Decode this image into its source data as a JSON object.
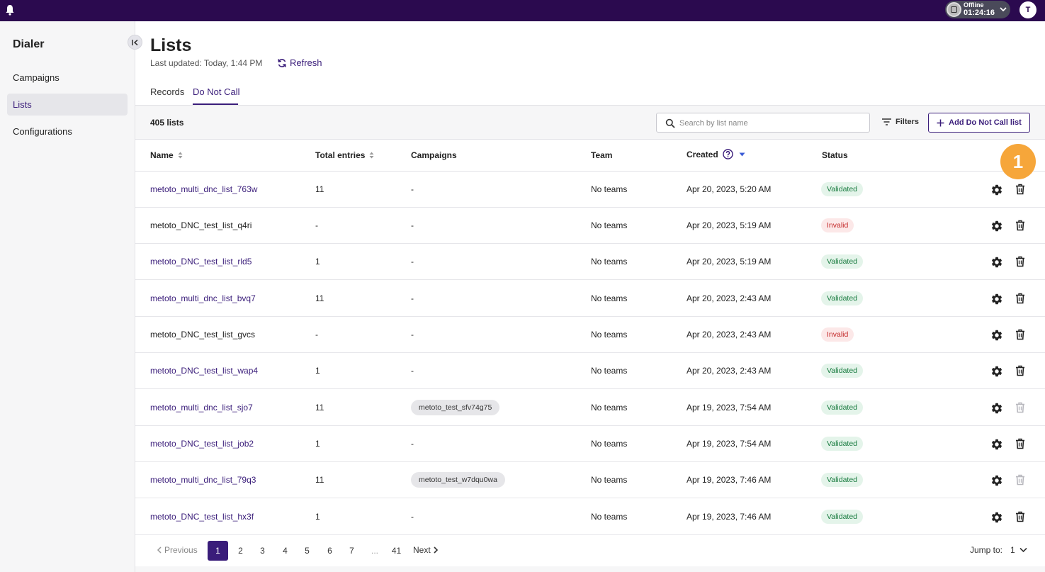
{
  "topbar": {
    "status_label": "Offline",
    "status_time": "01:24:16",
    "avatar_initial": "T",
    "bg_color": "#2b0a4f"
  },
  "sidebar": {
    "title": "Dialer",
    "items": [
      {
        "label": "Campaigns",
        "active": false
      },
      {
        "label": "Lists",
        "active": true
      },
      {
        "label": "Configurations",
        "active": false
      }
    ]
  },
  "header": {
    "title": "Lists",
    "last_updated": "Last updated: Today, 1:44 PM",
    "refresh_label": "Refresh"
  },
  "tabs": [
    {
      "label": "Records",
      "active": false
    },
    {
      "label": "Do Not Call",
      "active": true
    }
  ],
  "toolbar": {
    "count": "405 lists",
    "search_placeholder": "Search by list name",
    "filters_label": "Filters",
    "add_label": "Add Do Not Call list"
  },
  "table": {
    "columns": [
      "Name",
      "Total entries",
      "Campaigns",
      "Team",
      "Created",
      "Status"
    ],
    "rows": [
      {
        "name": "metoto_multi_dnc_list_763w",
        "link": true,
        "entries": "11",
        "campaign": "-",
        "chip": false,
        "team": "No teams",
        "created": "Apr 20, 2023, 5:20 AM",
        "status": "Validated",
        "trash_disabled": false
      },
      {
        "name": "metoto_DNC_test_list_q4ri",
        "link": false,
        "entries": "-",
        "campaign": "-",
        "chip": false,
        "team": "No teams",
        "created": "Apr 20, 2023, 5:19 AM",
        "status": "Invalid",
        "trash_disabled": false
      },
      {
        "name": "metoto_DNC_test_list_rld5",
        "link": true,
        "entries": "1",
        "campaign": "-",
        "chip": false,
        "team": "No teams",
        "created": "Apr 20, 2023, 5:19 AM",
        "status": "Validated",
        "trash_disabled": false
      },
      {
        "name": "metoto_multi_dnc_list_bvq7",
        "link": true,
        "entries": "11",
        "campaign": "-",
        "chip": false,
        "team": "No teams",
        "created": "Apr 20, 2023, 2:43 AM",
        "status": "Validated",
        "trash_disabled": false
      },
      {
        "name": "metoto_DNC_test_list_gvcs",
        "link": false,
        "entries": "-",
        "campaign": "-",
        "chip": false,
        "team": "No teams",
        "created": "Apr 20, 2023, 2:43 AM",
        "status": "Invalid",
        "trash_disabled": false
      },
      {
        "name": "metoto_DNC_test_list_wap4",
        "link": true,
        "entries": "1",
        "campaign": "-",
        "chip": false,
        "team": "No teams",
        "created": "Apr 20, 2023, 2:43 AM",
        "status": "Validated",
        "trash_disabled": false
      },
      {
        "name": "metoto_multi_dnc_list_sjo7",
        "link": true,
        "entries": "11",
        "campaign": "metoto_test_sfv74g75",
        "chip": true,
        "team": "No teams",
        "created": "Apr 19, 2023, 7:54 AM",
        "status": "Validated",
        "trash_disabled": true
      },
      {
        "name": "metoto_DNC_test_list_job2",
        "link": true,
        "entries": "1",
        "campaign": "-",
        "chip": false,
        "team": "No teams",
        "created": "Apr 19, 2023, 7:54 AM",
        "status": "Validated",
        "trash_disabled": false
      },
      {
        "name": "metoto_multi_dnc_list_79q3",
        "link": true,
        "entries": "11",
        "campaign": "metoto_test_w7dqu0wa",
        "chip": true,
        "team": "No teams",
        "created": "Apr 19, 2023, 7:46 AM",
        "status": "Validated",
        "trash_disabled": true
      },
      {
        "name": "metoto_DNC_test_list_hx3f",
        "link": true,
        "entries": "1",
        "campaign": "-",
        "chip": false,
        "team": "No teams",
        "created": "Apr 19, 2023, 7:46 AM",
        "status": "Validated",
        "trash_disabled": false
      }
    ]
  },
  "marker": "1",
  "pagination": {
    "previous_label": "Previous",
    "pages": [
      "1",
      "2",
      "3",
      "4",
      "5",
      "6",
      "7"
    ],
    "ellipsis": "...",
    "last_page": "41",
    "current": "1",
    "next_label": "Next",
    "jump_label": "Jump to:",
    "jump_value": "1"
  },
  "colors": {
    "accent": "#3a1d7a",
    "validated_bg": "#e4f4ea",
    "validated_text": "#177a3e",
    "invalid_bg": "#fce8e8",
    "invalid_text": "#c42b2b",
    "marker": "#f6a63a"
  }
}
